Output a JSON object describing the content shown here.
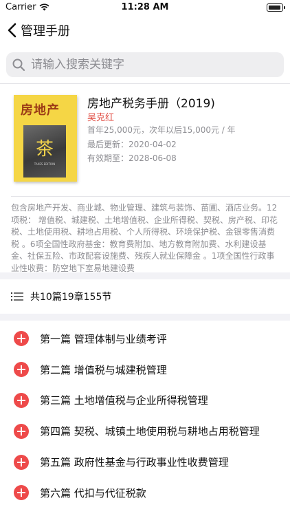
{
  "status_bar": {
    "carrier": "Carrier",
    "time": "11:28 AM"
  },
  "nav": {
    "back_title": "管理手册"
  },
  "search": {
    "placeholder": "请输入搜索关键字",
    "value": ""
  },
  "book": {
    "cover_title": "房地产",
    "cover_glyph": "茶",
    "cover_caption": "TAXES EDITION",
    "title": "房地产税务手册（2019)",
    "author": "吴克红",
    "price": "首年25,000元，次年以后15,000元 / 年",
    "updated": "最后更新：2020-04-02",
    "valid_until": "有效期至：2028-06-08"
  },
  "description": "包含房地产开发、商业城、物业管理、建筑与装饰、苗圃、酒店业务。12项税：    增值税、城建税、土地增值税、企业所得税、契税、房产税、印花税、土地使用税、耕地占用税、个人所得税、环境保护税、金银零售消费税 。6项全国性政府基金：教育费附加、地方教育附加费、水利建设基金、社保五险、市政配套设施费、残疾人就业保障金 。1项全国性行政事业性收费：防空地下室易地建设费",
  "toc": {
    "summary": "共10篇19章155节",
    "chapters": [
      {
        "label": "第一篇 管理体制与业绩考评"
      },
      {
        "label": "第二篇 增值税与城建税管理"
      },
      {
        "label": "第三篇 土地增值税与企业所得税管理"
      },
      {
        "label": "第四篇 契税、城镇土地使用税与耕地占用税管理"
      },
      {
        "label": "第五篇 政府性基金与行政事业性收费管理"
      },
      {
        "label": "第六篇 代扣与代征税款"
      }
    ]
  },
  "colors": {
    "accent_red": "#ee4a4a",
    "author_red": "#e0483e",
    "cover_yellow": "#f5d645",
    "secondary_text": "#8e8e93"
  }
}
